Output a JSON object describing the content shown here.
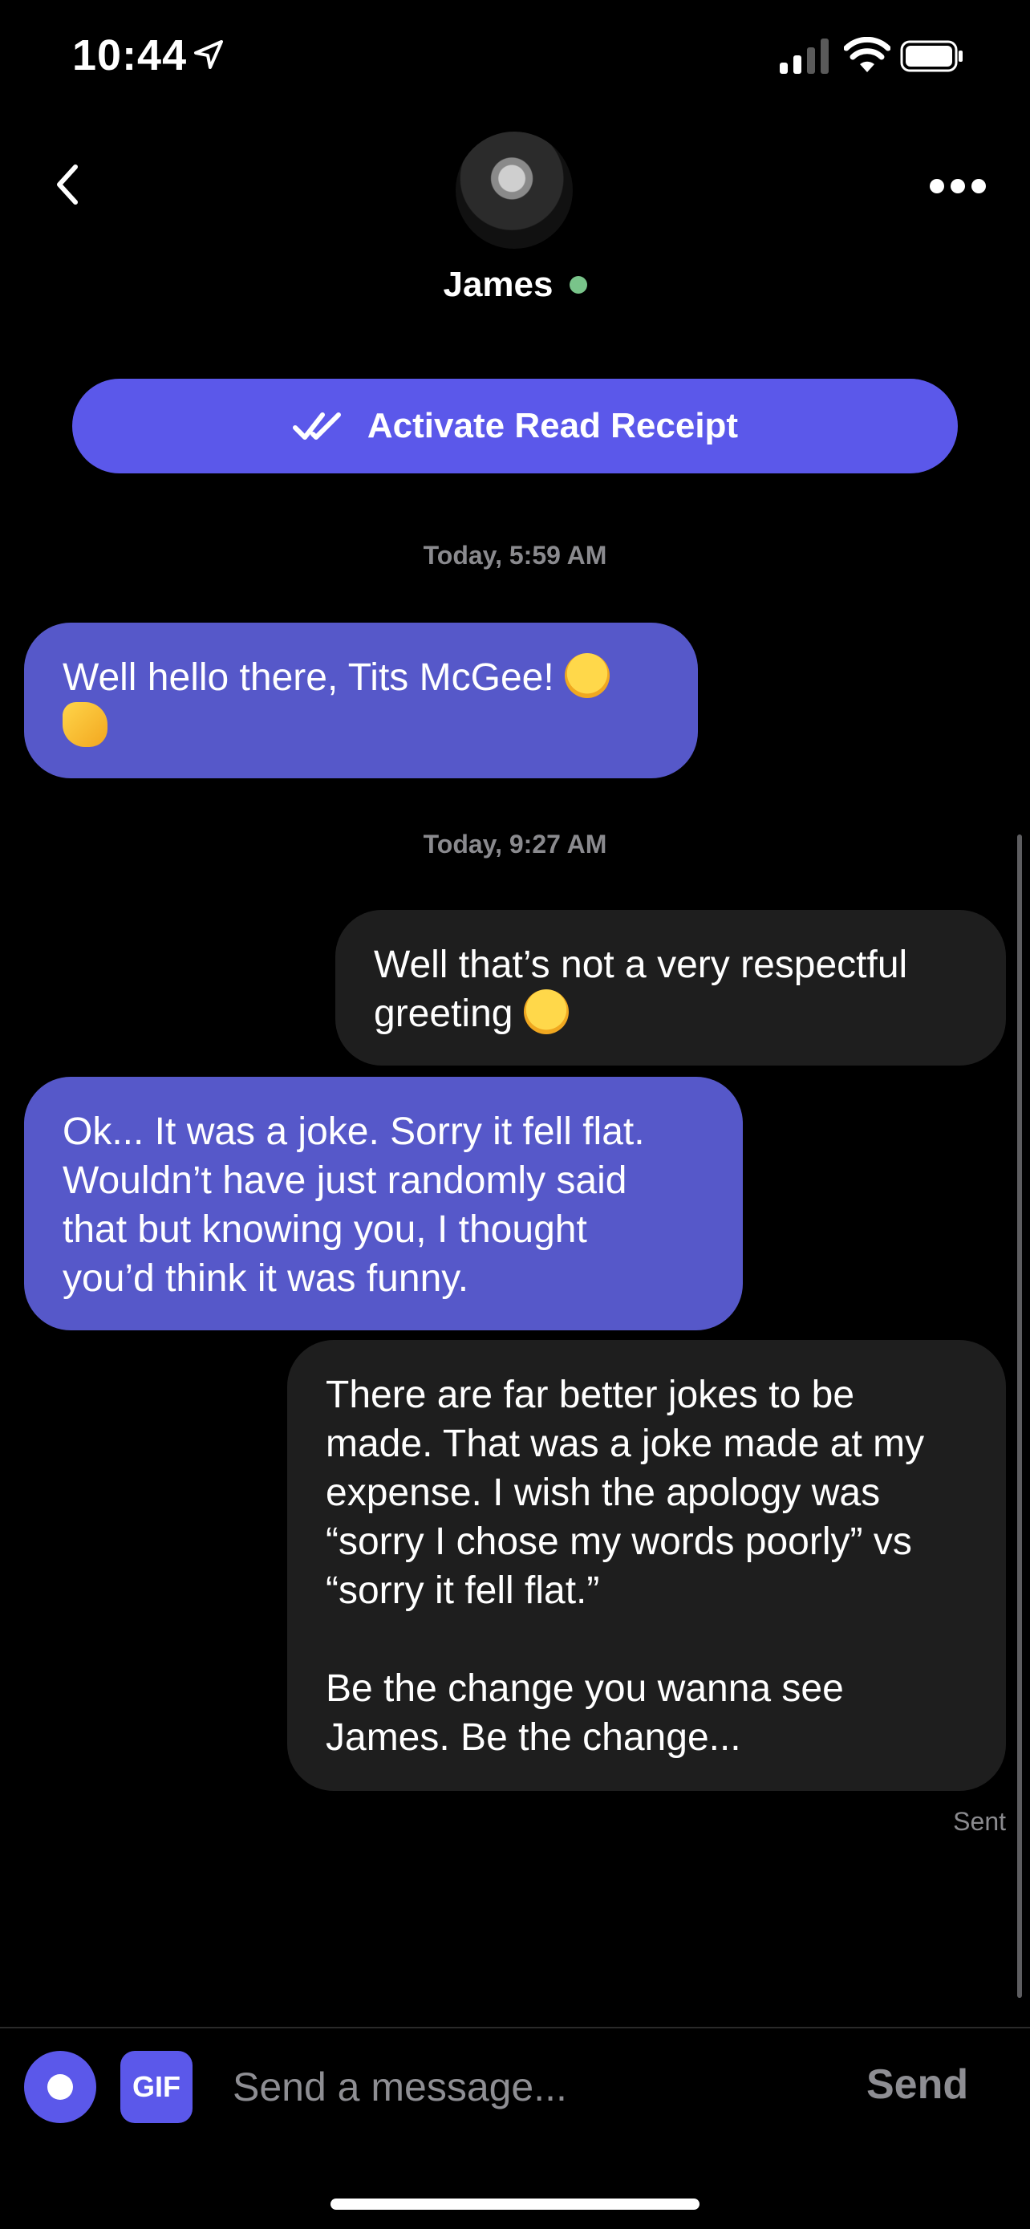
{
  "status_bar": {
    "time": "10:44"
  },
  "header": {
    "contact_name": "James",
    "online": true
  },
  "read_receipt_button": {
    "label": "Activate Read Receipt"
  },
  "messages": [
    {
      "type": "timestamp",
      "text": "Today, 5:59 AM"
    },
    {
      "type": "received",
      "text": "Well hello there, Tits McGee! ",
      "emoji": [
        "laughing-emoji",
        "waving-hand-emoji"
      ]
    },
    {
      "type": "timestamp",
      "text": "Today, 9:27 AM"
    },
    {
      "type": "sent",
      "text": "Well that’s not a very respectful\ngreeting ",
      "emoji": [
        "confused-face-emoji"
      ]
    },
    {
      "type": "received",
      "text": "Ok... It was a joke. Sorry it fell flat.\nWouldn’t have just randomly said\nthat but knowing you, I thought\nyou’d think it was funny."
    },
    {
      "type": "sent",
      "text": "There are far better jokes to be\nmade. That was a joke made at my\nexpense. I wish the apology was\n“sorry I chose my words poorly” vs\n“sorry it fell flat.”\n\nBe the change you wanna see\nJames. Be the change..."
    }
  ],
  "delivery_status": "Sent",
  "composer": {
    "gif_label": "GIF",
    "placeholder": "Send a message...",
    "send_label": "Send"
  },
  "colors": {
    "accent": "#5b58ea",
    "received_bubble": "#5658c9",
    "sent_bubble": "#1e1e1e",
    "online": "#79c48a"
  }
}
